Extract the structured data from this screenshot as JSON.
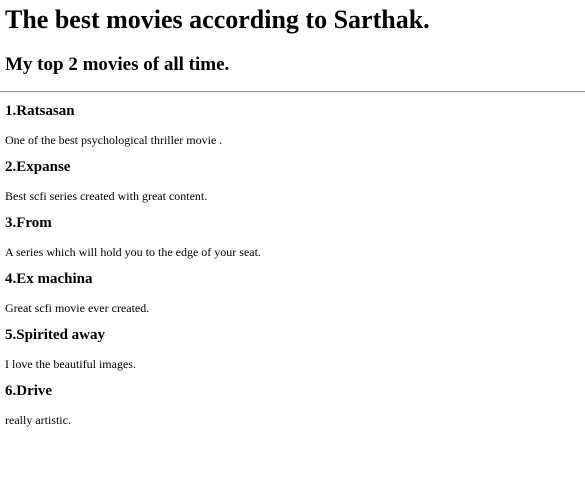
{
  "page": {
    "title": "The best movies according to Sarthak.",
    "subtitle": "My top 2 movies of all time."
  },
  "movies": [
    {
      "heading": "1.Ratsasan",
      "description": "One of the best psychological thriller movie ."
    },
    {
      "heading": "2.Expanse",
      "description": "Best scfi series created with great content."
    },
    {
      "heading": "3.From",
      "description": "A series which will hold you to the edge of your seat."
    },
    {
      "heading": "4.Ex machina",
      "description": "Great scfi movie ever created."
    },
    {
      "heading": "5.Spirited away",
      "description": "I love the beautiful images."
    },
    {
      "heading": "6.Drive",
      "description": "really artistic."
    }
  ]
}
